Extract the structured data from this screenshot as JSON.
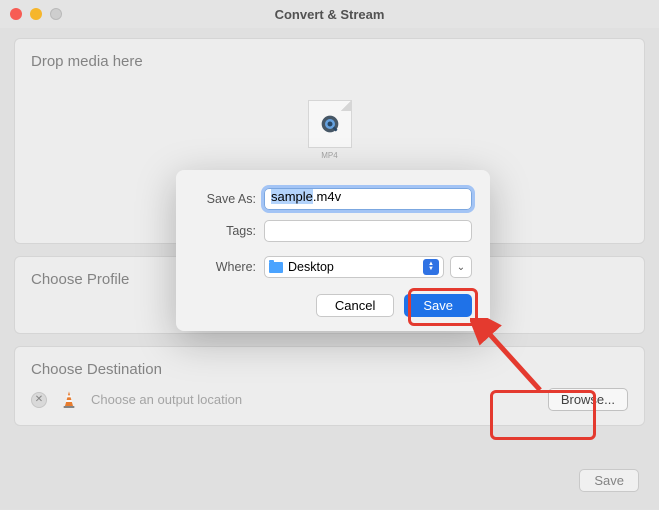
{
  "window": {
    "title": "Convert & Stream"
  },
  "drop": {
    "title": "Drop media here",
    "file_ext": "MP4"
  },
  "profile": {
    "title": "Choose Profile"
  },
  "destination": {
    "title": "Choose Destination",
    "placeholder": "Choose an output location",
    "browse_label": "Browse..."
  },
  "bottom": {
    "save_label": "Save"
  },
  "dialog": {
    "save_as_label": "Save As:",
    "tags_label": "Tags:",
    "where_label": "Where:",
    "filename_base": "sample",
    "filename_ext": ".m4v",
    "where_value": "Desktop",
    "cancel_label": "Cancel",
    "save_label": "Save"
  },
  "annotation": {
    "color": "#e43a2f"
  }
}
